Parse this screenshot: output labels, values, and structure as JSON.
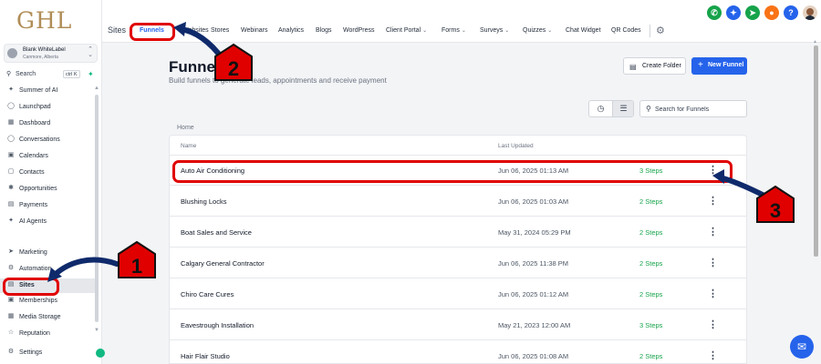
{
  "brand": {
    "logo": "GHL"
  },
  "account": {
    "name": "Blank WhiteLabel",
    "location": "Canmore, Alberta"
  },
  "sidebar": {
    "search_label": "Search",
    "search_shortcut": "ctrl K",
    "items": [
      {
        "label": "Summer of AI",
        "icon": "sparkle-icon"
      },
      {
        "label": "Launchpad",
        "icon": "rocket-icon"
      },
      {
        "label": "Dashboard",
        "icon": "dashboard-icon"
      },
      {
        "label": "Conversations",
        "icon": "chat-icon"
      },
      {
        "label": "Calendars",
        "icon": "calendar-icon"
      },
      {
        "label": "Contacts",
        "icon": "contacts-icon"
      },
      {
        "label": "Opportunities",
        "icon": "opportunities-icon"
      },
      {
        "label": "Payments",
        "icon": "payments-icon"
      },
      {
        "label": "AI Agents",
        "icon": "ai-agents-icon"
      },
      {
        "label": "Marketing",
        "icon": "marketing-icon"
      },
      {
        "label": "Automation",
        "icon": "automation-icon"
      },
      {
        "label": "Sites",
        "icon": "sites-icon",
        "active": true
      },
      {
        "label": "Memberships",
        "icon": "memberships-icon"
      },
      {
        "label": "Media Storage",
        "icon": "media-icon"
      },
      {
        "label": "Reputation",
        "icon": "reputation-icon"
      },
      {
        "label": "Settings",
        "icon": "gear-icon"
      }
    ]
  },
  "topnav": {
    "section_title": "Sites",
    "tabs": [
      {
        "label": "Funnels",
        "active": true
      },
      {
        "label": "Websites"
      },
      {
        "label": "Stores"
      },
      {
        "label": "Webinars"
      },
      {
        "label": "Analytics"
      },
      {
        "label": "Blogs"
      },
      {
        "label": "WordPress"
      },
      {
        "label": "Client Portal",
        "dropdown": true
      },
      {
        "label": "Forms",
        "dropdown": true
      },
      {
        "label": "Surveys",
        "dropdown": true
      },
      {
        "label": "Quizzes",
        "dropdown": true
      },
      {
        "label": "Chat Widget"
      },
      {
        "label": "QR Codes"
      }
    ],
    "icon_colors": {
      "phone": "#16a34a",
      "magic": "#2563eb",
      "megaphone": "#16a34a",
      "bell": "#f97316",
      "help": "#2563eb"
    }
  },
  "main": {
    "title": "Funnels",
    "subtitle": "Build funnels to generate leads, appointments and receive payment",
    "create_folder_label": "Create Folder",
    "new_funnel_label": "New Funnel",
    "search_placeholder": "Search for Funnels",
    "breadcrumb": "Home",
    "columns": {
      "name": "Name",
      "last_updated": "Last Updated"
    },
    "rows": [
      {
        "name": "Auto Air Conditioning",
        "updated": "Jun 06, 2025 01:13 AM",
        "steps": "3 Steps"
      },
      {
        "name": "Blushing Locks",
        "updated": "Jun 06, 2025 01:03 AM",
        "steps": "2 Steps"
      },
      {
        "name": "Boat Sales and Service",
        "updated": "May 31, 2024 05:29 PM",
        "steps": "2 Steps"
      },
      {
        "name": "Calgary General Contractor",
        "updated": "Jun 06, 2025 11:38 PM",
        "steps": "2 Steps"
      },
      {
        "name": "Chiro Care Cures",
        "updated": "Jun 06, 2025 01:12 AM",
        "steps": "2 Steps"
      },
      {
        "name": "Eavestrough Installation",
        "updated": "May 21, 2023 12:00 AM",
        "steps": "3 Steps"
      },
      {
        "name": "Hair Flair Studio",
        "updated": "Jun 06, 2025 01:08 AM",
        "steps": "2 Steps"
      }
    ]
  },
  "annotations": {
    "color": "#e00000",
    "numbers": [
      "1",
      "2",
      "3"
    ]
  }
}
